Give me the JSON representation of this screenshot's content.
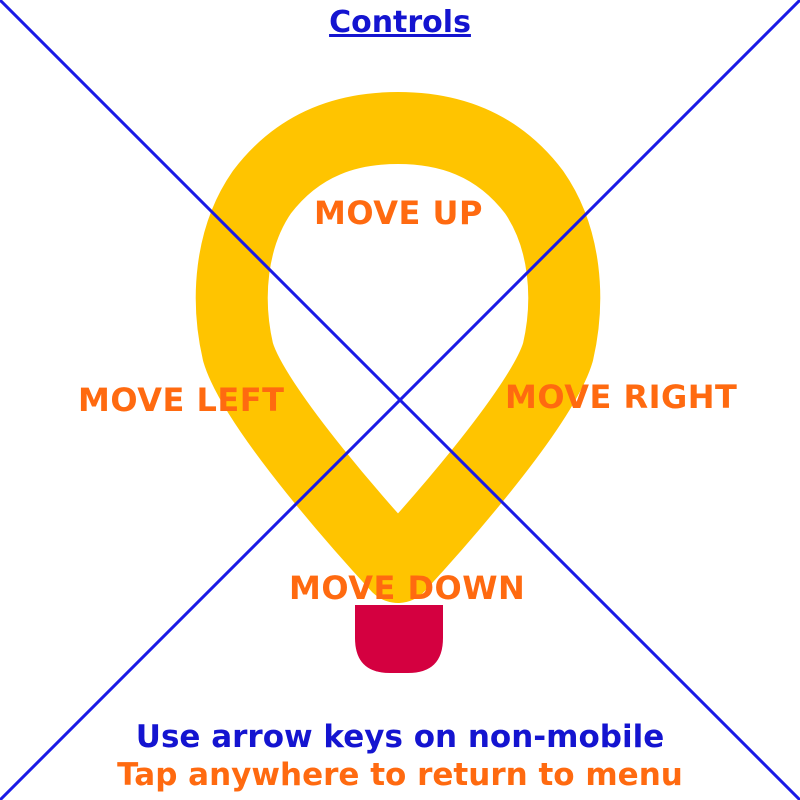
{
  "screen": {
    "title": "Controls",
    "background_color": "#ffffff"
  },
  "logo": {
    "icon": "lightbulb-pin-icon",
    "bulb_color": "#ffc400",
    "base_color": "#d40040"
  },
  "divider_color": "#1a1ae6",
  "title_color": "#1414d0",
  "zones": {
    "up": {
      "label": "MOVE UP",
      "color": "#ff6a10"
    },
    "left": {
      "label": "MOVE LEFT",
      "color": "#ff6a10"
    },
    "right": {
      "label": "MOVE RIGHT",
      "color": "#ff6a10"
    },
    "down": {
      "label": "MOVE DOWN",
      "color": "#ff6a10"
    }
  },
  "instructions": {
    "line1": "Use arrow keys on non-mobile",
    "line1_color": "#1414d0",
    "line2": "Tap anywhere to return to menu",
    "line2_color": "#ff6a10"
  }
}
